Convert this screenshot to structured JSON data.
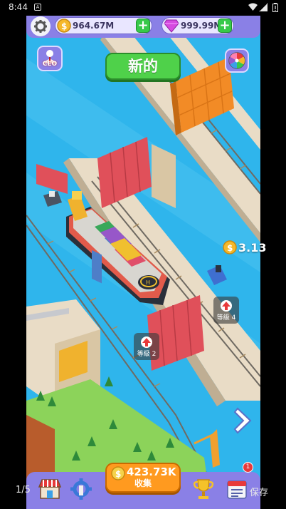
{
  "status_bar": {
    "time": "8:44",
    "notification": "A"
  },
  "hud": {
    "coins": "964.67M",
    "gems": "999.99M",
    "add_label": "+"
  },
  "ceo": {
    "label": "CEO"
  },
  "new_button": {
    "label": "新的"
  },
  "income_float": {
    "text": "3.13"
  },
  "level_badges": [
    {
      "text": "等級 2"
    },
    {
      "text": "等級 4"
    }
  ],
  "collect": {
    "amount": "423.73K",
    "label": "收集"
  },
  "bottom_bar": {
    "notification_count": "1"
  },
  "overlay": {
    "page_counter": "1/5",
    "save_label": "保存"
  },
  "colors": {
    "water": "#2fb5ec",
    "panel": "#8a80e6",
    "button_green": "#4fd14a",
    "button_orange": "#ff9a1f",
    "gate_red": "#e0505a",
    "gate_orange": "#f28b26",
    "grass": "#8cd35a"
  },
  "icons": [
    "gear-icon",
    "coin-icon",
    "gem-icon",
    "plus-icon",
    "ceo-icon",
    "prize-wheel-icon",
    "upgrade-arrow-icon",
    "next-arrow-icon",
    "shop-icon",
    "settings-cog-icon",
    "trophy-icon",
    "calendar-icon"
  ]
}
